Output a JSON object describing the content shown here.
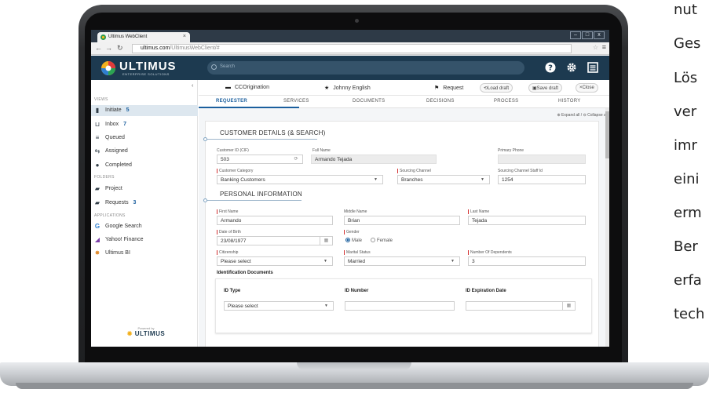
{
  "browser": {
    "tab_title": "Ultimus WebClient",
    "tab_close": "×",
    "url_host": "ultimus.com",
    "url_path": "/UltimusWebClient/#",
    "win_min": "–",
    "win_max": "□",
    "win_close": "x"
  },
  "app": {
    "logo_text": "ULTIMUS",
    "logo_sub": "ENTERPRISE SOLUTIONS",
    "search_placeholder": "Search",
    "powered_by": "Powered by",
    "powered_logo": "ULTIMUS"
  },
  "sidebar": {
    "views_label": "VIEWS",
    "folders_label": "FOLDERS",
    "applications_label": "APPLICATIONS",
    "views": [
      {
        "label": "Initiate",
        "count": "5",
        "icon": "document-icon"
      },
      {
        "label": "Inbox",
        "count": "7",
        "icon": "inbox-icon"
      },
      {
        "label": "Queued",
        "count": "",
        "icon": "stack-icon"
      },
      {
        "label": "Assigned",
        "count": "",
        "icon": "assign-icon"
      },
      {
        "label": "Completed",
        "count": "",
        "icon": "check-icon"
      }
    ],
    "folders": [
      {
        "label": "Project",
        "count": "",
        "icon": "folder-icon"
      },
      {
        "label": "Requests",
        "count": "3",
        "icon": "folder-icon"
      }
    ],
    "applications": [
      {
        "label": "Google Search",
        "icon": "google-icon"
      },
      {
        "label": "Yahoo! Finance",
        "icon": "chart-icon"
      },
      {
        "label": "Ultimus BI",
        "icon": "bi-icon"
      }
    ]
  },
  "infobar": {
    "origination": "CCOrigination",
    "user": "Johnny English",
    "request": "Request",
    "load_draft": "Load draft",
    "save_draft": "Save draft",
    "close": "Close"
  },
  "tabs": [
    "REQUESTER",
    "SERVICES",
    "DOCUMENTS",
    "DECISIONS",
    "PROCESS",
    "HISTORY"
  ],
  "expand_collapse": "⊕ Expand all / ⊖ Collapse all",
  "customer": {
    "heading": "CUSTOMER DETAILS (& SEARCH)",
    "cif_label": "Customer ID (CIF)",
    "cif_value": "503",
    "fullname_label": "Full Name",
    "fullname_value": "Armando Tejada",
    "phone_label": "Primary Phone",
    "phone_value": "",
    "category_label": "Customer Category",
    "category_value": "Banking Customers",
    "channel_label": "Sourcing Channel",
    "channel_value": "Branches",
    "staff_label": "Sourcing Channel Staff Id",
    "staff_value": "1254"
  },
  "personal": {
    "heading": "PERSONAL INFORMATION",
    "first_label": "First Name",
    "first_value": "Armando",
    "middle_label": "Middle Name",
    "middle_value": "Brian",
    "last_label": "Last Name",
    "last_value": "Tejada",
    "dob_label": "Date of Birth",
    "dob_value": "23/08/1977",
    "gender_label": "Gender",
    "gender_male": "Male",
    "gender_female": "Female",
    "citizenship_label": "Citizenship",
    "citizenship_value": "Please select",
    "marital_label": "Marital Status",
    "marital_value": "Married",
    "dependents_label": "Number Of Dependents",
    "dependents_value": "3",
    "id_docs_label": "Identification Documents",
    "id_type_label": "ID Type",
    "id_type_value": "Please select",
    "id_number_label": "ID Number",
    "id_expiry_label": "ID Expiration Date"
  },
  "side_text": [
    "nut",
    "Ges",
    "Lös",
    "ver",
    "imr",
    "eini",
    "erm",
    "Ber",
    "erfa",
    "tech"
  ]
}
